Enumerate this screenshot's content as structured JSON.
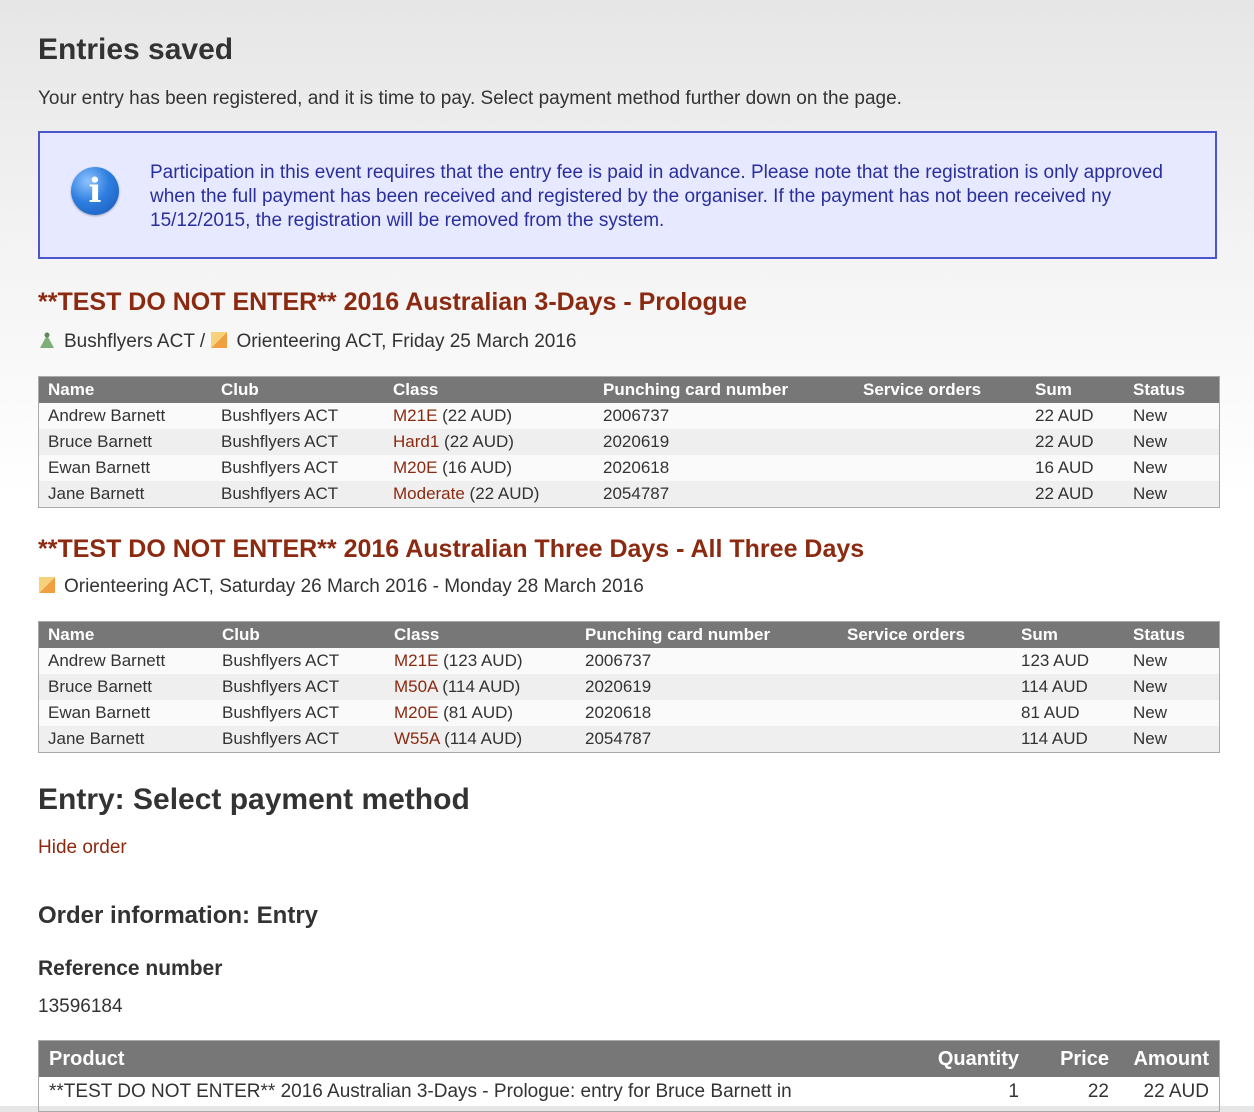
{
  "header": {
    "title": "Entries saved",
    "intro": "Your entry has been registered, and it is time to pay. Select payment method further down on the page."
  },
  "info": {
    "icon": "info-icon",
    "text": "Participation in this event requires that the entry fee is paid in advance. Please note that the registration is only approved when the full payment has been received and registered by the organiser. If the payment has not been received ny 15/12/2015, the registration will be removed from the system."
  },
  "columns": {
    "name": "Name",
    "club": "Club",
    "class": "Class",
    "card": "Punching card number",
    "service": "Service orders",
    "sum": "Sum",
    "status": "Status"
  },
  "events": [
    {
      "title": "**TEST DO NOT ENTER** 2016 Australian 3-Days - Prologue",
      "club": "Bushflyers ACT",
      "separator": " / ",
      "organiser": "Orienteering ACT, Friday 25 March 2016",
      "rows": [
        {
          "name": "Andrew Barnett",
          "club": "Bushflyers ACT",
          "class": "M21E",
          "class_fee": " (22 AUD)",
          "card": "2006737",
          "service": "",
          "sum": "22 AUD",
          "status": "New"
        },
        {
          "name": "Bruce Barnett",
          "club": "Bushflyers ACT",
          "class": "Hard1",
          "class_fee": " (22 AUD)",
          "card": "2020619",
          "service": "",
          "sum": "22 AUD",
          "status": "New"
        },
        {
          "name": "Ewan Barnett",
          "club": "Bushflyers ACT",
          "class": "M20E",
          "class_fee": " (16 AUD)",
          "card": "2020618",
          "service": "",
          "sum": "16 AUD",
          "status": "New"
        },
        {
          "name": "Jane Barnett",
          "club": "Bushflyers ACT",
          "class": "Moderate",
          "class_fee": " (22 AUD)",
          "card": "2054787",
          "service": "",
          "sum": "22 AUD",
          "status": "New"
        }
      ]
    },
    {
      "title": "**TEST DO NOT ENTER** 2016 Australian Three Days - All Three Days",
      "organiser": "Orienteering ACT, Saturday 26 March 2016 - Monday 28 March 2016",
      "rows": [
        {
          "name": "Andrew Barnett",
          "club": "Bushflyers ACT",
          "class": "M21E",
          "class_fee": " (123 AUD)",
          "card": "2006737",
          "service": "",
          "sum": "123 AUD",
          "status": "New"
        },
        {
          "name": "Bruce Barnett",
          "club": "Bushflyers ACT",
          "class": "M50A",
          "class_fee": " (114 AUD)",
          "card": "2020619",
          "service": "",
          "sum": "114 AUD",
          "status": "New"
        },
        {
          "name": "Ewan Barnett",
          "club": "Bushflyers ACT",
          "class": "M20E",
          "class_fee": " (81 AUD)",
          "card": "2020618",
          "service": "",
          "sum": "81 AUD",
          "status": "New"
        },
        {
          "name": "Jane Barnett",
          "club": "Bushflyers ACT",
          "class": "W55A",
          "class_fee": " (114 AUD)",
          "card": "2054787",
          "service": "",
          "sum": "114 AUD",
          "status": "New"
        }
      ]
    }
  ],
  "payment": {
    "title": "Entry: Select payment method",
    "hide_order": "Hide order",
    "order_title": "Order information: Entry",
    "reference_label": "Reference number",
    "reference_value": "13596184",
    "product_columns": {
      "product": "Product",
      "quantity": "Quantity",
      "price": "Price",
      "amount": "Amount"
    },
    "products": [
      {
        "product": "**TEST DO NOT ENTER** 2016 Australian 3-Days - Prologue: entry for Bruce Barnett in",
        "quantity": "1",
        "price": "22",
        "amount": "22 AUD"
      }
    ]
  }
}
